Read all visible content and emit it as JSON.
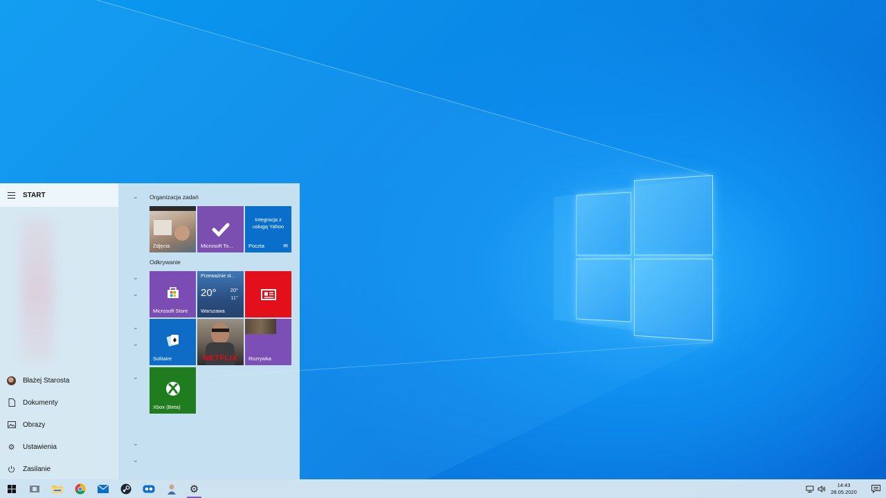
{
  "start_menu": {
    "title": "START",
    "nav": [
      {
        "label": "Błażej Starosta",
        "icon": "user-avatar"
      },
      {
        "label": "Dokumenty",
        "icon": "document-icon"
      },
      {
        "label": "Obrazy",
        "icon": "pictures-icon"
      },
      {
        "label": "Ustawienia",
        "icon": "gear-icon"
      },
      {
        "label": "Zasilanie",
        "icon": "power-icon"
      }
    ],
    "groups": [
      {
        "title": "Organizacja zadań"
      },
      {
        "title": "Odkrywanie"
      }
    ],
    "tiles": {
      "photos": {
        "label": "Zdjęcia"
      },
      "todo": {
        "label": "Microsoft To..."
      },
      "mail": {
        "label": "Poczta",
        "text": "Integracja z usługą Yahoo"
      },
      "store": {
        "label": "Microsoft Store"
      },
      "weather": {
        "label": "Warszawa",
        "condition": "Przeważnie sł...",
        "temp": "20°",
        "high": "20°",
        "low": "11°"
      },
      "news": {
        "label": ""
      },
      "solitaire": {
        "label": "Solitaire"
      },
      "netflix": {
        "label": "NETFLIX"
      },
      "games": {
        "label": "Rozrywka"
      },
      "xbox": {
        "label": "Xbox (Beta)"
      }
    }
  },
  "taskbar": {
    "clock_time": "14:43",
    "clock_date": "28.05.2020",
    "icons": [
      "start-button",
      "task-view-icon",
      "file-explorer-icon",
      "chrome-icon",
      "mail-icon",
      "steam-icon",
      "app-icon",
      "user-app-icon",
      "settings-icon"
    ]
  },
  "colors": {
    "todo": "#7a4fb0",
    "mail": "#0a6fcb",
    "store": "#7b4cb4",
    "weather": "#2b4f82",
    "news": "#e3101c",
    "solitaire": "#0f6cc6",
    "games": "#7c4fb6",
    "xbox": "#1f7d1f"
  }
}
